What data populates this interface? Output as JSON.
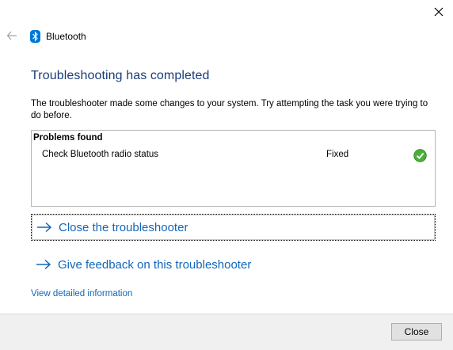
{
  "window": {
    "app_title": "Bluetooth"
  },
  "main": {
    "heading": "Troubleshooting has completed",
    "description": "The troubleshooter made some changes to your system. Try attempting the task you were trying to do before."
  },
  "problems": {
    "header": "Problems found",
    "items": [
      {
        "name": "Check Bluetooth radio status",
        "status": "Fixed",
        "status_icon": "green-check-icon"
      }
    ]
  },
  "actions": {
    "close_troubleshooter": "Close the troubleshooter",
    "give_feedback": "Give feedback on this troubleshooter",
    "view_details": "View detailed information"
  },
  "footer": {
    "close_label": "Close"
  },
  "colors": {
    "link": "#1166bb",
    "heading": "#1a3c7a",
    "bluetooth": "#0078d7",
    "success": "#4caf3a"
  }
}
